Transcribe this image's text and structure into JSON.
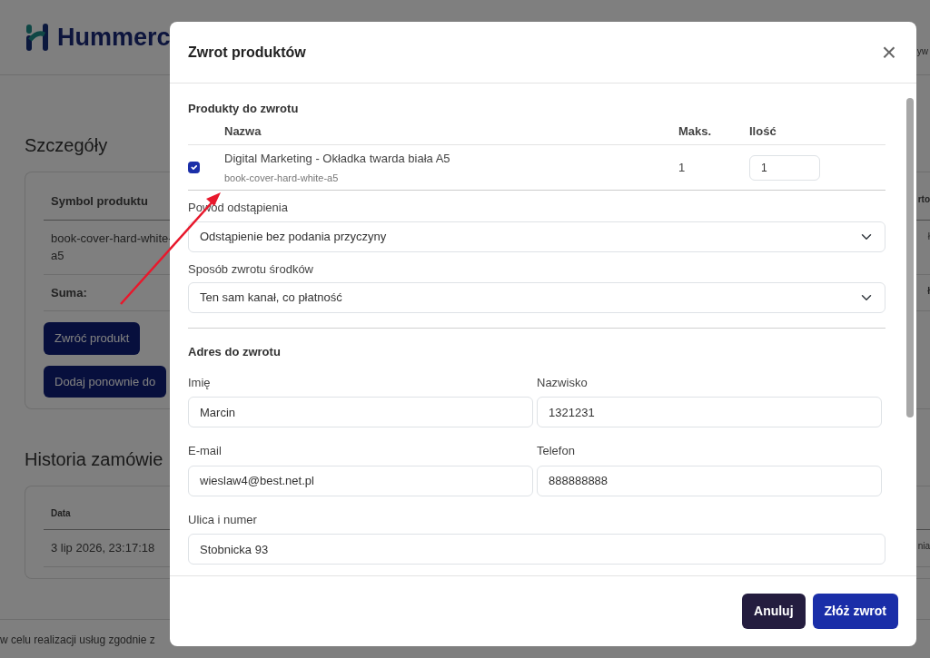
{
  "page": {
    "logo_text": "Hummerc",
    "header_right": "yw",
    "section_title": "Szczegóły",
    "details_table": {
      "columns": [
        "Symbol produktu",
        "rto"
      ],
      "rows": [
        [
          "book-cover-hard-white-a5",
          "ł"
        ]
      ],
      "total_label": "Suma:",
      "total_value": "ł"
    },
    "buttons": [
      "Zwróć produkt",
      "Dodaj ponownie do"
    ],
    "history_title": "Historia zamówie",
    "history_table": {
      "columns": [
        "Data"
      ],
      "rows": [
        [
          "3 lip 2026, 23:17:18",
          "nia"
        ]
      ]
    },
    "footer_text": "w celu realizacji usług zgodnie z"
  },
  "modal": {
    "title": "Zwrot produktów",
    "close": "×",
    "products_heading": "Produkty do zwrotu",
    "columns": [
      "Nazwa",
      "Maks.",
      "Ilość"
    ],
    "products": [
      {
        "name": "Digital Marketing - Okładka twarda biała A5",
        "sku": "book-cover-hard-white-a5",
        "max": "1",
        "quantity": "1",
        "checked": true
      }
    ],
    "selects": [
      {
        "label": "Powód odstąpienia",
        "value": "Odstąpienie bez podania przyczyny"
      },
      {
        "label": "Sposób zwrotu środków",
        "value": "Ten sam kanał, co płatność"
      }
    ],
    "address_heading": "Adres do zwrotu",
    "fields": [
      {
        "label": "Imię",
        "value": "Marcin",
        "wide": false
      },
      {
        "label": "Nazwisko",
        "value": "1321231",
        "wide": false
      },
      {
        "label": "E-mail",
        "value": "wieslaw4@best.net.pl",
        "wide": false
      },
      {
        "label": "Telefon",
        "value": "888888888",
        "wide": false
      },
      {
        "label": "Ulica i numer",
        "value": "Stobnicka 93",
        "wide": true
      }
    ],
    "buttons": [
      {
        "label": "Anuluj",
        "kind": "secondary"
      },
      {
        "label": "Złóż zwrot",
        "kind": "primary"
      }
    ]
  }
}
